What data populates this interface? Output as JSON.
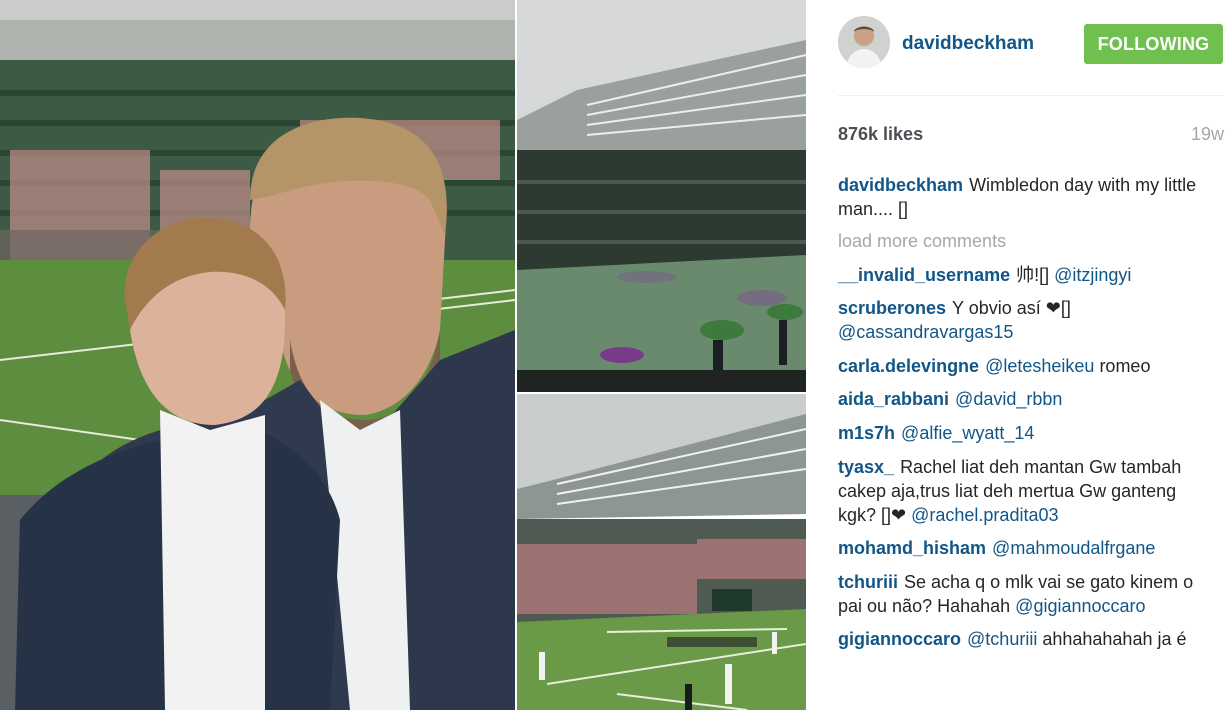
{
  "post": {
    "username": "davidbeckham",
    "follow_label": "FOLLOWING",
    "likes": "876k likes",
    "age": "19w"
  },
  "caption": {
    "username": "davidbeckham",
    "text": "Wimbledon day with my little man.... []"
  },
  "load_more_label": "load more comments",
  "comments": [
    {
      "username": "__invalid_username",
      "text": "帅![]",
      "mention": "@itzjingyi"
    },
    {
      "username": "scruberones",
      "text": "Y obvio así ❤[]",
      "mention": "@cassandravargas15"
    },
    {
      "username": "carla.delevingne",
      "text": "",
      "mention": "@letesheikeu",
      "after": "romeo"
    },
    {
      "username": "aida_rabbani",
      "text": "",
      "mention": "@david_rbbn"
    },
    {
      "username": "m1s7h",
      "text": "",
      "mention": "@alfie_wyatt_14"
    },
    {
      "username": "tyasx_",
      "text": "Rachel liat deh mantan Gw tambah cakep aja,trus liat deh mertua Gw ganteng kgk? []❤",
      "mention": "@rachel.pradita03"
    },
    {
      "username": "mohamd_hisham",
      "text": "",
      "mention": "@mahmoudalfrgane"
    },
    {
      "username": "tchuriii",
      "text": "Se acha q o mlk vai se gato kinem o pai ou não? Hahahah",
      "mention": "@gigiannoccaro"
    },
    {
      "username": "gigiannoccaro",
      "text": "",
      "mention": "@tchuriii",
      "after": "ahhahahahah ja é"
    }
  ],
  "colors": {
    "link_blue": "#125688",
    "follow_green": "#70c050",
    "muted_gray": "#a5a7aa"
  }
}
